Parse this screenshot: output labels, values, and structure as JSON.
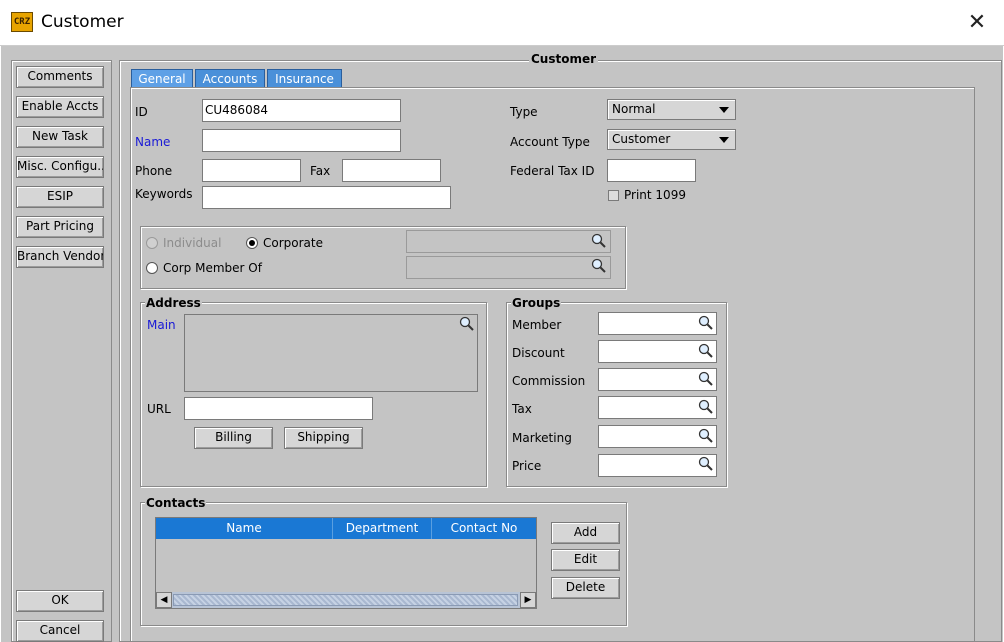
{
  "window": {
    "title": "Customer",
    "app_icon_text": "CRZ"
  },
  "left_buttons": {
    "comments": "Comments",
    "enable_accts": "Enable Accts",
    "new_task": "New Task",
    "misc_config": "Misc. Configu...",
    "esip": "ESIP",
    "part_pricing": "Part Pricing",
    "branch_vendor": "Branch Vendor",
    "ok": "OK",
    "cancel": "Cancel"
  },
  "panel_title": "Customer",
  "tabs": [
    {
      "label": "General",
      "active": true
    },
    {
      "label": "Accounts",
      "active": false
    },
    {
      "label": "Insurance",
      "active": false
    }
  ],
  "general": {
    "id_label": "ID",
    "id_value": "CU486084",
    "name_label": "Name",
    "name_value": "",
    "phone_label": "Phone",
    "phone_value": "",
    "fax_label": "Fax",
    "fax_value": "",
    "keywords_label": "Keywords",
    "keywords_value": "",
    "type_label": "Type",
    "type_value": "Normal",
    "account_type_label": "Account Type",
    "account_type_value": "Customer",
    "federal_tax_label": "Federal Tax ID",
    "federal_tax_value": "",
    "print1099_label": "Print 1099",
    "individual_label": "Individual",
    "corporate_label": "Corporate",
    "corp_member_label": "Corp Member Of"
  },
  "address": {
    "title": "Address",
    "main_label": "Main",
    "url_label": "URL",
    "billing": "Billing",
    "shipping": "Shipping"
  },
  "groups": {
    "title": "Groups",
    "items": [
      "Member",
      "Discount",
      "Commission",
      "Tax",
      "Marketing",
      "Price"
    ]
  },
  "contacts": {
    "title": "Contacts",
    "columns": [
      "Name",
      "Department",
      "Contact No"
    ],
    "add": "Add",
    "edit": "Edit",
    "delete": "Delete"
  },
  "colors": {
    "tab_blue": "#4a90d9",
    "header_blue": "#1a78d4",
    "link_blue": "#1a1ad6",
    "bg_gray": "#c4c4c4"
  }
}
